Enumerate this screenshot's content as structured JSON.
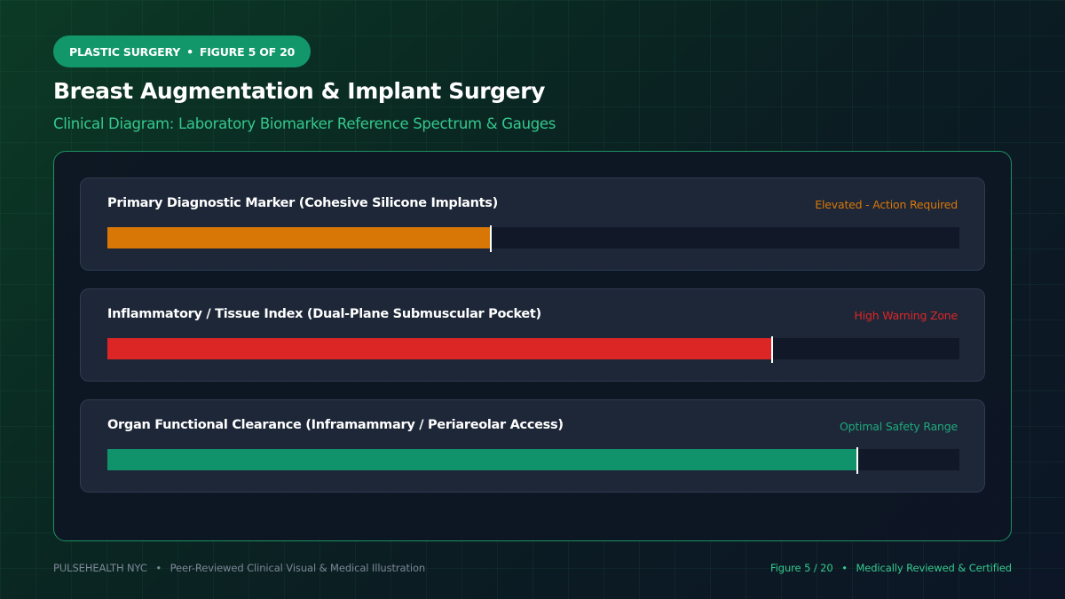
{
  "header": {
    "category": "PLASTIC SURGERY",
    "separator": "•",
    "figure": "FIGURE 5 OF 20",
    "title": "Breast Augmentation & Implant Surgery",
    "subtitle": "Clinical Diagram: Laboratory Biomarker Reference Spectrum & Gauges"
  },
  "colors": {
    "accent": "#12976a",
    "orange": "#d97706",
    "red": "#dc2626",
    "green": "#10936a"
  },
  "gauges": [
    {
      "label": "Primary Diagnostic Marker (Cohesive Silicone Implants)",
      "status": "Elevated - Action Required",
      "status_color": "#d97706",
      "fill_color": "#d97706",
      "level": 0.45
    },
    {
      "label": "Inflammatory / Tissue Index (Dual-Plane Submuscular Pocket)",
      "status": "High Warning Zone",
      "status_color": "#dc2626",
      "fill_color": "#dc2626",
      "level": 0.78
    },
    {
      "label": "Organ Functional Clearance (Inframammary / Periareolar Access)",
      "status": "Optimal Safety Range",
      "status_color": "#1ea97a",
      "fill_color": "#10936a",
      "level": 0.88
    }
  ],
  "footer": {
    "brand": "PULSEHEALTH NYC",
    "separator": "•",
    "tagline": "Peer-Reviewed Clinical Visual & Medical Illustration",
    "figure": "Figure 5 / 20",
    "certification": "Medically Reviewed & Certified"
  }
}
